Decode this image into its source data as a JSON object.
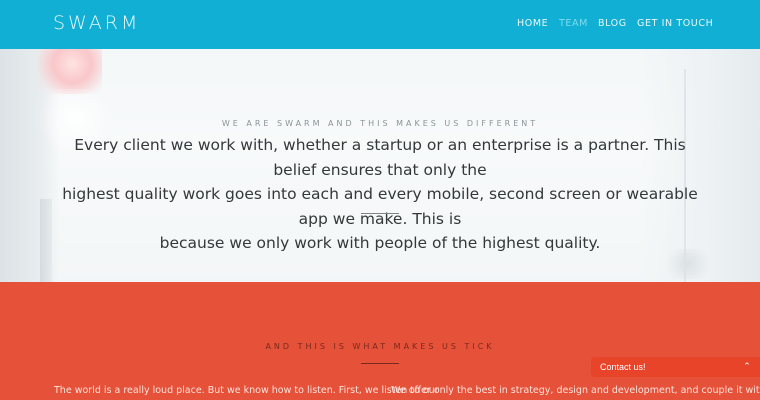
{
  "header": {
    "logo": "SWARM",
    "nav": [
      {
        "label": "HOME"
      },
      {
        "label": "TEAM"
      },
      {
        "label": "BLOG"
      },
      {
        "label": "GET IN TOUCH"
      }
    ],
    "active": "TEAM",
    "colors": {
      "bar": "#11afd4",
      "active_link": "#7fdcef"
    }
  },
  "hero": {
    "eyebrow": "WE ARE SWARM AND THIS MAKES US DIFFERENT",
    "statement_lines": [
      "Every client we work with, whether a startup or an enterprise is a partner. This belief ensures that only the",
      "highest quality work goes into each and every mobile, second screen or wearable app we make. This is",
      "because we only work with people of the highest quality."
    ]
  },
  "ticks": {
    "title": "AND THIS IS WHAT MAKES US TICK",
    "columns": [
      "The world is a really loud place. But we know how to listen. First, we listen to our",
      "We offer only the best in strategy, design and development, and couple it with our"
    ],
    "color": "#e55139"
  },
  "contact_widget": {
    "label": "Contact us!",
    "icon": "chevron-up-icon",
    "color": "#e8442a"
  }
}
